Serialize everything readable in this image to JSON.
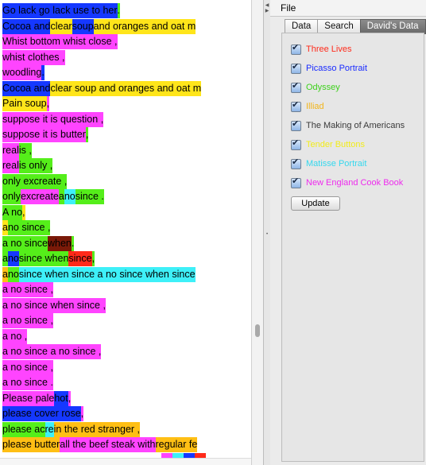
{
  "menu": {
    "file": "File"
  },
  "tabs": [
    {
      "label": "Data",
      "active": false
    },
    {
      "label": "Search",
      "active": false
    },
    {
      "label": "David's Data",
      "active": true
    }
  ],
  "sources": [
    {
      "label": "Three Lives",
      "color": "#ff2a1a",
      "checked": true
    },
    {
      "label": "Picasso Portrait",
      "color": "#1a2cff",
      "checked": true
    },
    {
      "label": "Odyssey",
      "color": "#3ed11c",
      "checked": true
    },
    {
      "label": "Illiad",
      "color": "#f2b51a",
      "checked": true
    },
    {
      "label": "The Making of Americans",
      "color": "#3a3a3a",
      "checked": true
    },
    {
      "label": "Tender Buttons",
      "color": "#f2ec1a",
      "checked": true
    },
    {
      "label": "Matisse Portrait",
      "color": "#35d8ee",
      "checked": true
    },
    {
      "label": "New England Cook Book",
      "color": "#ee2cee",
      "checked": true
    }
  ],
  "update_label": "Update",
  "palette": {
    "B": "#1538ff",
    "Y": "#ffe51a",
    "O": "#ffbf14",
    "G": "#55ee1a",
    "M": "#ff44ff",
    "C": "#3ef0f8",
    "R": "#ff2a1a",
    "D": "#7a1a08",
    "W": "#ffffff"
  },
  "text_lines": [
    [
      [
        "Go lack go lack use to her",
        "B"
      ],
      [
        ".",
        "G"
      ]
    ],
    [
      [
        "Cocoa and ",
        "B"
      ],
      [
        "clear ",
        "Y"
      ],
      [
        "soup ",
        "B"
      ],
      [
        "and oranges and oat m",
        "Y"
      ]
    ],
    [
      [
        "Whist bottom whist close ,",
        "M"
      ]
    ],
    [
      [
        "whist clothes ,",
        "M"
      ]
    ],
    [
      [
        "woodling ",
        "M"
      ],
      [
        ".",
        "B"
      ]
    ],
    [
      [
        "Cocoa and ",
        "B"
      ],
      [
        "clear soup and oranges and oat m",
        "Y"
      ]
    ],
    [
      [
        "Pain soup ",
        "Y"
      ],
      [
        ",",
        "M"
      ]
    ],
    [
      [
        "suppose it is question ,",
        "M"
      ]
    ],
    [
      [
        "suppose it is butter ",
        "M"
      ],
      [
        ",",
        "G"
      ]
    ],
    [
      [
        "real ",
        "M"
      ],
      [
        "is ,",
        "G"
      ]
    ],
    [
      [
        "real ",
        "M"
      ],
      [
        "is only ,",
        "G"
      ]
    ],
    [
      [
        "only excreate ,",
        "G"
      ]
    ],
    [
      [
        "only ",
        "G"
      ],
      [
        "excreate ",
        "M"
      ],
      [
        "a ",
        "G"
      ],
      [
        "no ",
        "C"
      ],
      [
        "since .",
        "G"
      ]
    ],
    [
      [
        "A no ",
        "G"
      ],
      [
        ",",
        "Y"
      ]
    ],
    [
      [
        "a ",
        "Y"
      ],
      [
        "no since ,",
        "G"
      ]
    ],
    [
      [
        "a no since ",
        "G"
      ],
      [
        "when ",
        "D"
      ],
      [
        ".",
        "G"
      ]
    ],
    [
      [
        "a ",
        "G"
      ],
      [
        "no ",
        "B"
      ],
      [
        "since when ",
        "G"
      ],
      [
        "since ",
        "R"
      ],
      [
        ",",
        "G"
      ]
    ],
    [
      [
        "a ",
        "O"
      ],
      [
        "no ",
        "G"
      ],
      [
        "since when since a no since when since",
        "C"
      ]
    ],
    [
      [
        "a no since ,",
        "M"
      ]
    ],
    [
      [
        "a no since when since ,",
        "M"
      ]
    ],
    [
      [
        "a no since ,",
        "M"
      ]
    ],
    [
      [
        "a no ,",
        "M"
      ]
    ],
    [
      [
        "a no since a no since ,",
        "M"
      ]
    ],
    [
      [
        "a no since ,",
        "M"
      ]
    ],
    [
      [
        "a no since .",
        "M"
      ]
    ],
    [
      [
        "Please pale ",
        "M"
      ],
      [
        "hot ",
        "B"
      ],
      [
        ",",
        "M"
      ]
    ],
    [
      [
        "please cover rose ",
        "B"
      ],
      [
        ",",
        "M"
      ]
    ],
    [
      [
        "please ac",
        "G"
      ],
      [
        "re ",
        "C"
      ],
      [
        "in the red stranger ,",
        "O"
      ]
    ],
    [
      [
        "please butter ",
        "O"
      ],
      [
        "all the beef steak with ",
        "M"
      ],
      [
        "regular fe",
        "O"
      ]
    ],
    [
      [
        "",
        "W"
      ],
      [
        "",
        "M"
      ],
      [
        "",
        "C"
      ],
      [
        "",
        "B"
      ],
      [
        "",
        "R"
      ]
    ]
  ]
}
